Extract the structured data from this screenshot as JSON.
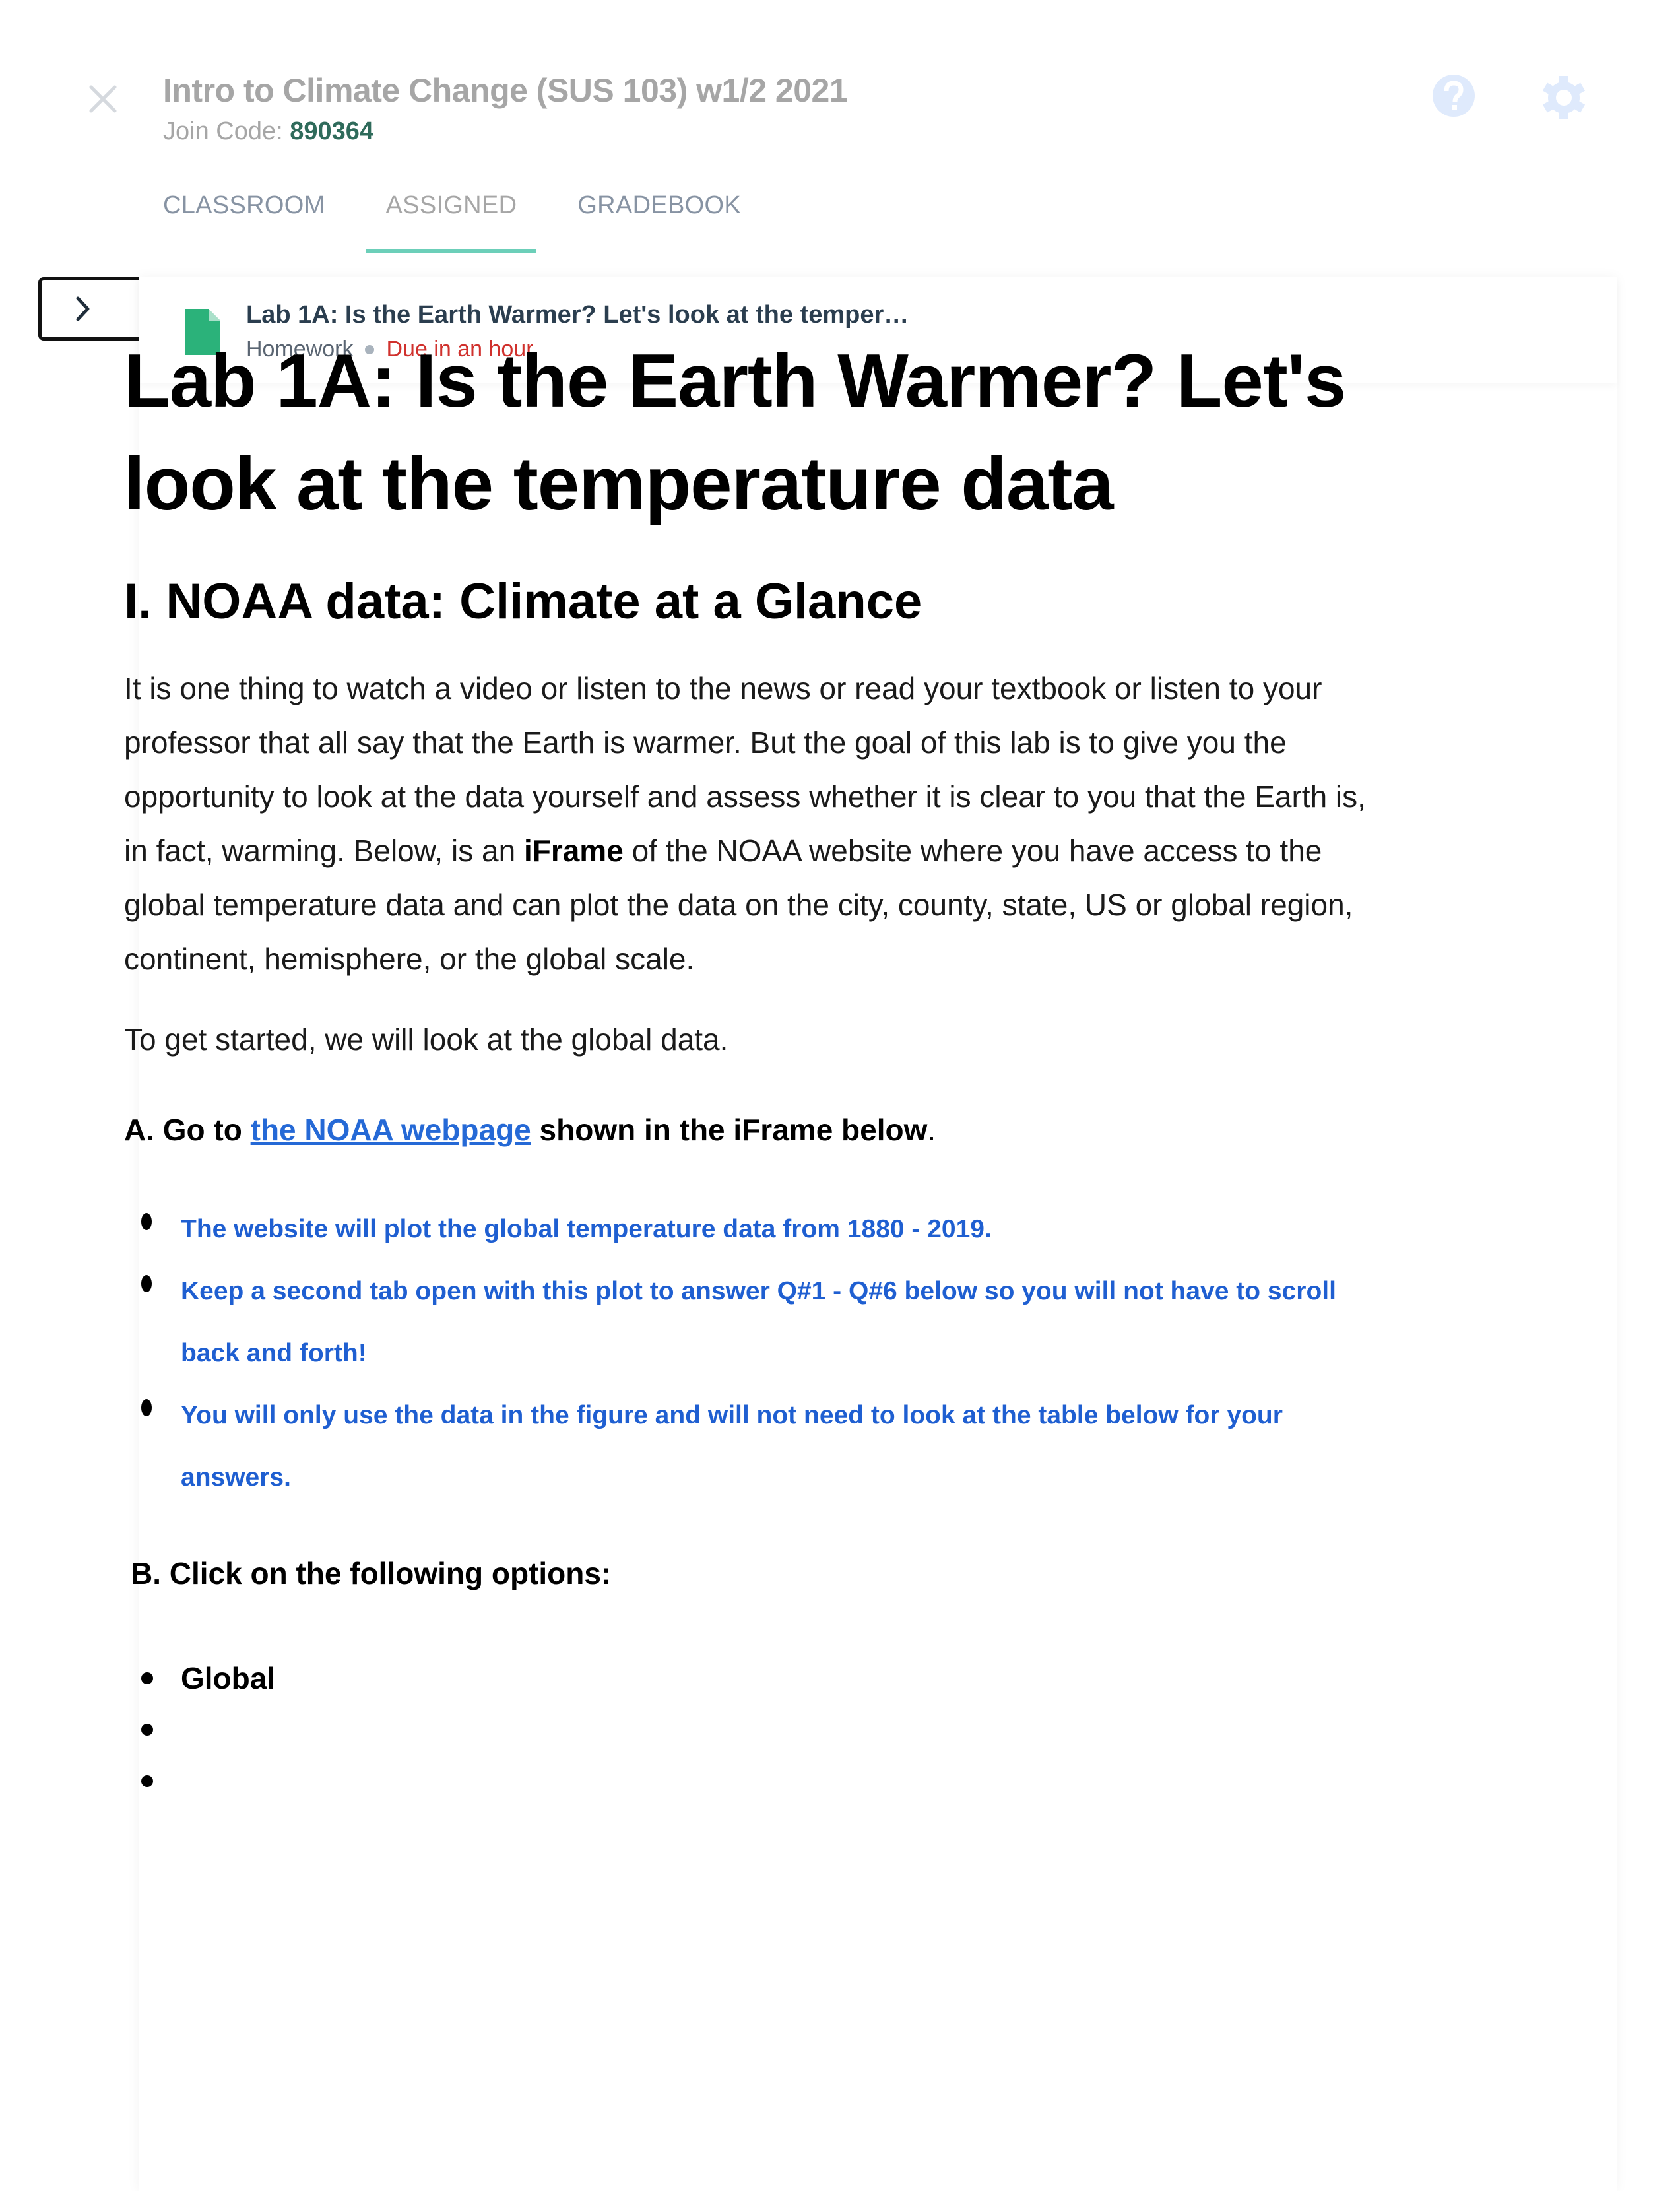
{
  "header": {
    "course_title": "Intro to Climate Change (SUS 103) w1/2 2021",
    "join_code_label": "Join Code:",
    "join_code": "890364",
    "close_icon": "close-icon",
    "help_icon": "help-circle-icon",
    "settings_icon": "gear-icon"
  },
  "tabs": [
    {
      "label": "CLASSROOM",
      "active": false
    },
    {
      "label": "ASSIGNED",
      "active": true
    },
    {
      "label": "GRADEBOOK",
      "active": false
    }
  ],
  "assignment": {
    "title": "Lab 1A: Is the Earth Warmer? Let's look at the temper…",
    "type": "Homework",
    "due": "Due in an hour",
    "icon": "document-icon"
  },
  "colors": {
    "accent": "#6ccfb9",
    "join_code": "#2f6b5b",
    "due": "#d0312d",
    "link": "#2569d6",
    "blue_text": "#1f5fd1",
    "doc_icon": "#2bb27a",
    "icon_light": "#dfeafc"
  },
  "content": {
    "title": "Lab 1A: Is the Earth Warmer?  Let's look at the temperature data",
    "section_heading": "I. NOAA data: Climate at a Glance",
    "intro_before_bold": "It is one thing to watch a video or listen to the news or read your textbook or listen to your professor that all say that the Earth is warmer.  But the goal of this lab is to give you the opportunity to look at the data yourself and assess whether it is clear to you that the Earth is, in fact, warming.  Below, is an ",
    "intro_bold": "iFrame",
    "intro_after_bold": " of the NOAA website where you have access to the global temperature data and can plot the data on the city, county, state, US or global region, continent, hemisphere,  or the global scale.",
    "getting_started": "To get started, we will look at the global data.",
    "step_a_prefix": "A. Go to ",
    "step_a_link": "the NOAA webpage",
    "step_a_suffix": " shown in the iFrame below",
    "step_a_period": ".",
    "notes": [
      "The website will plot the global temperature data from 1880 - 2019.",
      "Keep a second tab open with this plot to answer Q#1 - Q#6 below so you will not have to scroll back and forth!",
      "You will only use the data in the figure and will not need to look at the table below for your answers."
    ],
    "step_b": "B. Click on the following options:",
    "options": [
      "Global",
      "",
      ""
    ]
  }
}
